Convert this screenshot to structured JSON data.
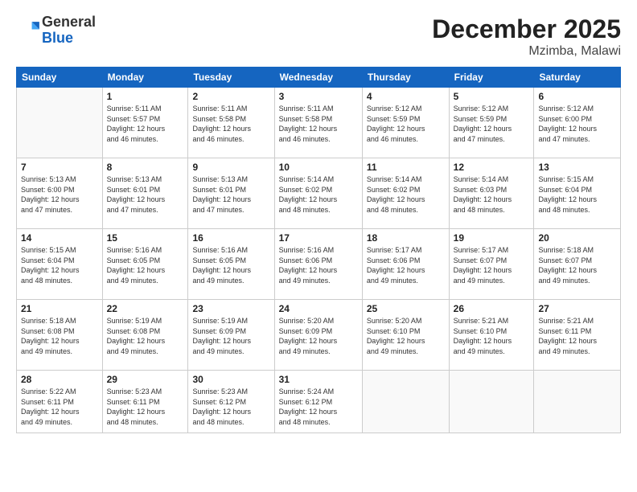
{
  "logo": {
    "general": "General",
    "blue": "Blue"
  },
  "title": "December 2025",
  "subtitle": "Mzimba, Malawi",
  "days_of_week": [
    "Sunday",
    "Monday",
    "Tuesday",
    "Wednesday",
    "Thursday",
    "Friday",
    "Saturday"
  ],
  "weeks": [
    [
      {
        "day": "",
        "info": ""
      },
      {
        "day": "1",
        "info": "Sunrise: 5:11 AM\nSunset: 5:57 PM\nDaylight: 12 hours\nand 46 minutes."
      },
      {
        "day": "2",
        "info": "Sunrise: 5:11 AM\nSunset: 5:58 PM\nDaylight: 12 hours\nand 46 minutes."
      },
      {
        "day": "3",
        "info": "Sunrise: 5:11 AM\nSunset: 5:58 PM\nDaylight: 12 hours\nand 46 minutes."
      },
      {
        "day": "4",
        "info": "Sunrise: 5:12 AM\nSunset: 5:59 PM\nDaylight: 12 hours\nand 46 minutes."
      },
      {
        "day": "5",
        "info": "Sunrise: 5:12 AM\nSunset: 5:59 PM\nDaylight: 12 hours\nand 47 minutes."
      },
      {
        "day": "6",
        "info": "Sunrise: 5:12 AM\nSunset: 6:00 PM\nDaylight: 12 hours\nand 47 minutes."
      }
    ],
    [
      {
        "day": "7",
        "info": "Sunrise: 5:13 AM\nSunset: 6:00 PM\nDaylight: 12 hours\nand 47 minutes."
      },
      {
        "day": "8",
        "info": "Sunrise: 5:13 AM\nSunset: 6:01 PM\nDaylight: 12 hours\nand 47 minutes."
      },
      {
        "day": "9",
        "info": "Sunrise: 5:13 AM\nSunset: 6:01 PM\nDaylight: 12 hours\nand 47 minutes."
      },
      {
        "day": "10",
        "info": "Sunrise: 5:14 AM\nSunset: 6:02 PM\nDaylight: 12 hours\nand 48 minutes."
      },
      {
        "day": "11",
        "info": "Sunrise: 5:14 AM\nSunset: 6:02 PM\nDaylight: 12 hours\nand 48 minutes."
      },
      {
        "day": "12",
        "info": "Sunrise: 5:14 AM\nSunset: 6:03 PM\nDaylight: 12 hours\nand 48 minutes."
      },
      {
        "day": "13",
        "info": "Sunrise: 5:15 AM\nSunset: 6:04 PM\nDaylight: 12 hours\nand 48 minutes."
      }
    ],
    [
      {
        "day": "14",
        "info": "Sunrise: 5:15 AM\nSunset: 6:04 PM\nDaylight: 12 hours\nand 48 minutes."
      },
      {
        "day": "15",
        "info": "Sunrise: 5:16 AM\nSunset: 6:05 PM\nDaylight: 12 hours\nand 49 minutes."
      },
      {
        "day": "16",
        "info": "Sunrise: 5:16 AM\nSunset: 6:05 PM\nDaylight: 12 hours\nand 49 minutes."
      },
      {
        "day": "17",
        "info": "Sunrise: 5:16 AM\nSunset: 6:06 PM\nDaylight: 12 hours\nand 49 minutes."
      },
      {
        "day": "18",
        "info": "Sunrise: 5:17 AM\nSunset: 6:06 PM\nDaylight: 12 hours\nand 49 minutes."
      },
      {
        "day": "19",
        "info": "Sunrise: 5:17 AM\nSunset: 6:07 PM\nDaylight: 12 hours\nand 49 minutes."
      },
      {
        "day": "20",
        "info": "Sunrise: 5:18 AM\nSunset: 6:07 PM\nDaylight: 12 hours\nand 49 minutes."
      }
    ],
    [
      {
        "day": "21",
        "info": "Sunrise: 5:18 AM\nSunset: 6:08 PM\nDaylight: 12 hours\nand 49 minutes."
      },
      {
        "day": "22",
        "info": "Sunrise: 5:19 AM\nSunset: 6:08 PM\nDaylight: 12 hours\nand 49 minutes."
      },
      {
        "day": "23",
        "info": "Sunrise: 5:19 AM\nSunset: 6:09 PM\nDaylight: 12 hours\nand 49 minutes."
      },
      {
        "day": "24",
        "info": "Sunrise: 5:20 AM\nSunset: 6:09 PM\nDaylight: 12 hours\nand 49 minutes."
      },
      {
        "day": "25",
        "info": "Sunrise: 5:20 AM\nSunset: 6:10 PM\nDaylight: 12 hours\nand 49 minutes."
      },
      {
        "day": "26",
        "info": "Sunrise: 5:21 AM\nSunset: 6:10 PM\nDaylight: 12 hours\nand 49 minutes."
      },
      {
        "day": "27",
        "info": "Sunrise: 5:21 AM\nSunset: 6:11 PM\nDaylight: 12 hours\nand 49 minutes."
      }
    ],
    [
      {
        "day": "28",
        "info": "Sunrise: 5:22 AM\nSunset: 6:11 PM\nDaylight: 12 hours\nand 49 minutes."
      },
      {
        "day": "29",
        "info": "Sunrise: 5:23 AM\nSunset: 6:11 PM\nDaylight: 12 hours\nand 48 minutes."
      },
      {
        "day": "30",
        "info": "Sunrise: 5:23 AM\nSunset: 6:12 PM\nDaylight: 12 hours\nand 48 minutes."
      },
      {
        "day": "31",
        "info": "Sunrise: 5:24 AM\nSunset: 6:12 PM\nDaylight: 12 hours\nand 48 minutes."
      },
      {
        "day": "",
        "info": ""
      },
      {
        "day": "",
        "info": ""
      },
      {
        "day": "",
        "info": ""
      }
    ]
  ]
}
